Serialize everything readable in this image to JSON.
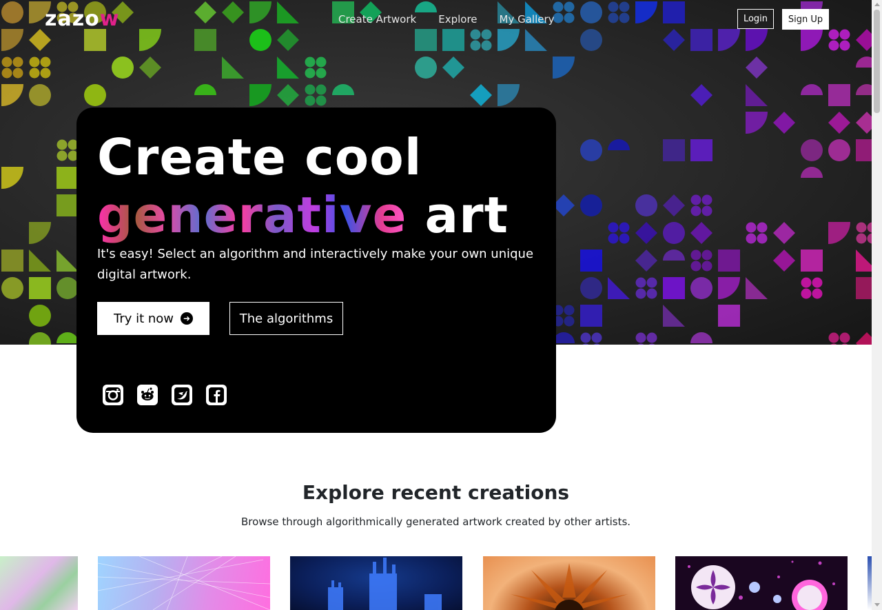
{
  "nav": {
    "logo_main": "zazo",
    "logo_accent": "w",
    "links": [
      "Create Artwork",
      "Explore",
      "My Gallery"
    ],
    "login": "Login",
    "signup": "Sign Up"
  },
  "hero": {
    "title_line1": "Create cool",
    "title_accent": "generative",
    "title_end": "art",
    "lead": "It's easy! Select an algorithm and interactively make your own unique digital artwork.",
    "try_label": "Try it now",
    "algorithms_label": "The algorithms",
    "socials": [
      "instagram-icon",
      "reddit-icon",
      "twitter-icon",
      "facebook-icon"
    ]
  },
  "explore": {
    "title": "Explore recent creations",
    "subtitle": "Browse through algorithmically generated artwork created by other artists."
  },
  "colors": {
    "brand_accent": "#e0218a",
    "hero_bg": "#262626",
    "card_bg": "#000000"
  }
}
